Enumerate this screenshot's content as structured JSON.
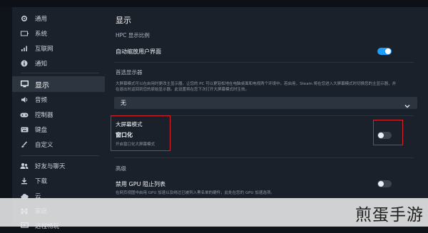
{
  "sidebar": {
    "items": [
      {
        "label": "通用",
        "icon": "gear-icon"
      },
      {
        "label": "系统",
        "icon": "battery-icon"
      },
      {
        "label": "互联网",
        "icon": "wifi-icon"
      },
      {
        "label": "通知",
        "icon": "info-icon"
      },
      {
        "label": "显示",
        "icon": "monitor-icon",
        "active": true
      },
      {
        "label": "音频",
        "icon": "speaker-icon"
      },
      {
        "label": "控制器",
        "icon": "gamepad-icon"
      },
      {
        "label": "键盘",
        "icon": "keyboard-icon"
      },
      {
        "label": "自定义",
        "icon": "brush-icon"
      },
      {
        "label": "好友与聊天",
        "icon": "friends-icon"
      },
      {
        "label": "下载",
        "icon": "download-icon"
      },
      {
        "label": "云",
        "icon": "cloud-icon"
      },
      {
        "label": "家庭",
        "icon": "family-icon"
      },
      {
        "label": "远程畅玩",
        "icon": "remote-play-icon"
      }
    ]
  },
  "main": {
    "title": "显示",
    "hpc": {
      "heading": "HPC 显示比例",
      "auto_scale_label": "自动缩放用户界面",
      "auto_scale_on": true
    },
    "preferred": {
      "heading": "首选显示器",
      "description": "大屏幕模式可以在启用时更改主显示器。让您的 PC 可以更轻松地在电脑桌面和电视两个环境中。若启用，Steam 将在您进入大屏幕模式时切换您的主显示器，并在退出时返回到您的原始显示器。此设置将在您下次打开大屏幕模式时生效。",
      "value": "无"
    },
    "bigpicture": {
      "heading": "大屏幕模式",
      "windowed_label": "窗口化",
      "windowed_desc": "开启窗口化大屏幕模式",
      "windowed_on": false
    },
    "advanced": {
      "heading": "高级",
      "gpu_label": "禁用 GPU 阻止列表",
      "gpu_desc": "在网页视图中启用 GPU 加速以及绕过已被列入黑名单的硬件，此处在您的 GPU 加速选项。",
      "gpu_on": false
    }
  },
  "watermark": "煎蛋手游",
  "colors": {
    "accent": "#1a9fff",
    "highlight": "#d9232a",
    "panel": "#1b212b"
  }
}
